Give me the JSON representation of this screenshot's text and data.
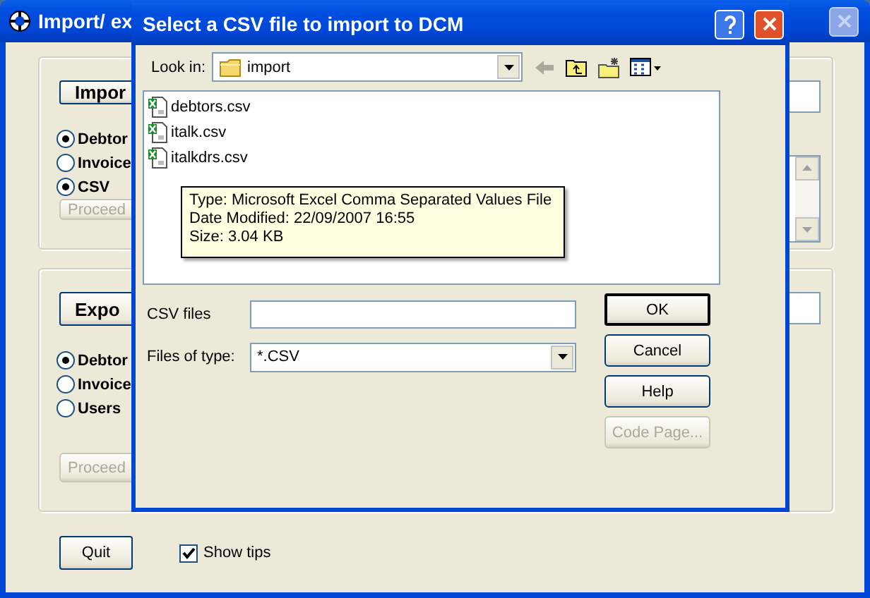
{
  "main_window": {
    "title": "Import/ ex",
    "import_group": {
      "button": "Impor",
      "options": [
        {
          "label": "Debtor",
          "selected": true
        },
        {
          "label": "Invoice",
          "selected": false
        },
        {
          "label": "CSV",
          "selected": true
        }
      ],
      "proceed": {
        "label": "Proceed",
        "disabled": true
      }
    },
    "export_group": {
      "button": "Expo",
      "options": [
        {
          "label": "Debtor",
          "selected": true
        },
        {
          "label": "Invoice",
          "selected": false
        },
        {
          "label": "Users",
          "selected": false
        }
      ],
      "proceed": {
        "label": "Proceed",
        "disabled": true
      }
    },
    "quit": "Quit",
    "show_tips": {
      "label": "Show tips",
      "checked": true
    }
  },
  "dialog": {
    "title": "Select a CSV file to import to DCM",
    "look_in": {
      "label": "Look in:",
      "value": "import"
    },
    "files": [
      {
        "name": "debtors.csv"
      },
      {
        "name": "italk.csv"
      },
      {
        "name": "italkdrs.csv"
      }
    ],
    "tooltip": [
      "Type: Microsoft Excel Comma Separated Values File",
      "Date Modified: 22/09/2007 16:55",
      "Size: 3.04 KB"
    ],
    "file_name": {
      "label": "CSV files"
    },
    "file_type": {
      "label": "Files of type:",
      "value": "*.CSV"
    },
    "buttons": [
      {
        "label": "OK",
        "default": true,
        "disabled": false
      },
      {
        "label": "Cancel",
        "default": false,
        "disabled": false
      },
      {
        "label": "Help",
        "default": false,
        "disabled": false
      },
      {
        "label": "Code Page...",
        "default": false,
        "disabled": true
      }
    ]
  }
}
